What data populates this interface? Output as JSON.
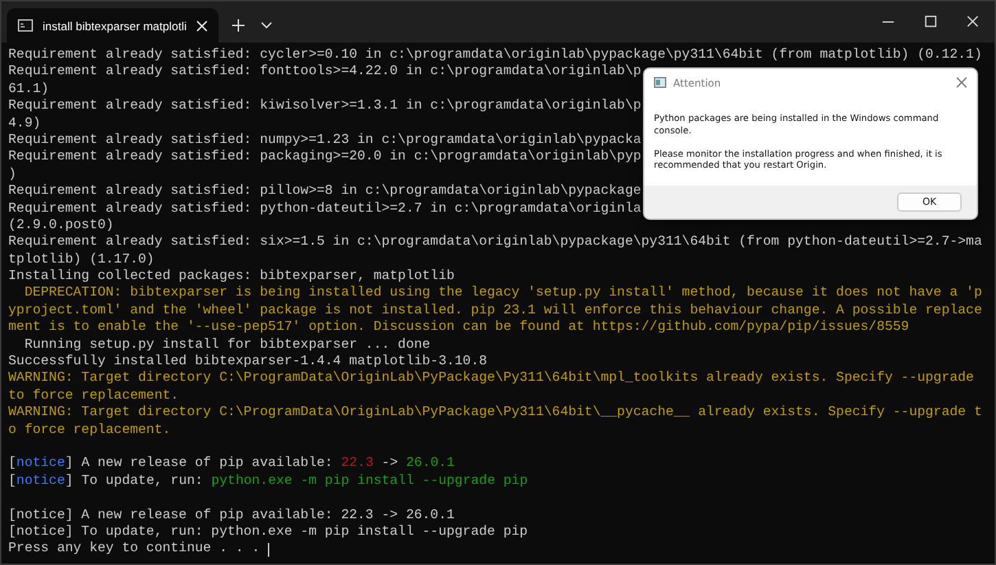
{
  "window": {
    "tab_title": "install bibtexparser matplotli"
  },
  "console": {
    "lines": [
      {
        "kind": "text",
        "segments": [
          {
            "kind": "plain",
            "text": "Requirement already satisfied: cycler>=0.10 in c:\\programdata\\originlab\\pypackage\\py311\\64bit (from matplotlib) (0.12.1)"
          }
        ]
      },
      {
        "kind": "text",
        "segments": [
          {
            "kind": "plain",
            "text": "Requirement already satisfied: fonttools>=4.22.0 in c:\\programdata\\originlab\\p"
          }
        ]
      },
      {
        "kind": "text",
        "segments": [
          {
            "kind": "plain",
            "text": "61.1)"
          }
        ]
      },
      {
        "kind": "text",
        "segments": [
          {
            "kind": "plain",
            "text": "Requirement already satisfied: kiwisolver>=1.3.1 in c:\\programdata\\originlab\\p"
          }
        ]
      },
      {
        "kind": "text",
        "segments": [
          {
            "kind": "plain",
            "text": "4.9)"
          }
        ]
      },
      {
        "kind": "text",
        "segments": [
          {
            "kind": "plain",
            "text": "Requirement already satisfied: numpy>=1.23 in c:\\programdata\\originlab\\pypacka"
          }
        ]
      },
      {
        "kind": "text",
        "segments": [
          {
            "kind": "plain",
            "text": "Requirement already satisfied: packaging>=20.0 in c:\\programdata\\originlab\\pyp"
          }
        ]
      },
      {
        "kind": "text",
        "segments": [
          {
            "kind": "plain",
            "text": ")"
          }
        ]
      },
      {
        "kind": "text",
        "segments": [
          {
            "kind": "plain",
            "text": "Requirement already satisfied: pillow>=8 in c:\\programdata\\originlab\\pypackage"
          }
        ]
      },
      {
        "kind": "text",
        "segments": [
          {
            "kind": "plain",
            "text": "Requirement already satisfied: python-dateutil>=2.7 in c:\\programdata\\originla"
          }
        ]
      },
      {
        "kind": "text",
        "segments": [
          {
            "kind": "plain",
            "text": "(2.9.0.post0)"
          }
        ]
      },
      {
        "kind": "text",
        "segments": [
          {
            "kind": "plain",
            "text": "Requirement already satisfied: six>=1.5 in c:\\programdata\\originlab\\pypackage\\py311\\64bit (from python-dateutil>=2.7->ma"
          }
        ]
      },
      {
        "kind": "text",
        "segments": [
          {
            "kind": "plain",
            "text": "tplotlib) (1.17.0)"
          }
        ]
      },
      {
        "kind": "text",
        "segments": [
          {
            "kind": "plain",
            "text": "Installing collected packages: bibtexparser, matplotlib"
          }
        ]
      },
      {
        "kind": "text",
        "segments": [
          {
            "kind": "warning",
            "text": "  DEPRECATION: bibtexparser is being installed using the legacy 'setup.py install' method, because it does not have a 'p"
          }
        ]
      },
      {
        "kind": "text",
        "segments": [
          {
            "kind": "warning",
            "text": "yproject.toml' and the 'wheel' package is not installed. pip 23.1 will enforce this behaviour change. A possible replace"
          }
        ]
      },
      {
        "kind": "text",
        "segments": [
          {
            "kind": "warning",
            "text": "ment is to enable the '--use-pep517' option. Discussion can be found at https://github.com/pypa/pip/issues/8559"
          }
        ]
      },
      {
        "kind": "text",
        "segments": [
          {
            "kind": "plain",
            "text": "  Running setup.py install for bibtexparser ... done"
          }
        ]
      },
      {
        "kind": "text",
        "segments": [
          {
            "kind": "plain",
            "text": "Successfully installed bibtexparser-1.4.4 matplotlib-3.10.8"
          }
        ]
      },
      {
        "kind": "text",
        "segments": [
          {
            "kind": "warning",
            "text": "WARNING: Target directory C:\\ProgramData\\OriginLab\\PyPackage\\Py311\\64bit\\mpl_toolkits already exists. Specify --upgrade"
          }
        ]
      },
      {
        "kind": "text",
        "segments": [
          {
            "kind": "warning",
            "text": "to force replacement."
          }
        ]
      },
      {
        "kind": "text",
        "segments": [
          {
            "kind": "warning",
            "text": "WARNING: Target directory C:\\ProgramData\\OriginLab\\PyPackage\\Py311\\64bit\\__pycache__ already exists. Specify --upgrade t"
          }
        ]
      },
      {
        "kind": "text",
        "segments": [
          {
            "kind": "warning",
            "text": "o force replacement."
          }
        ]
      },
      {
        "kind": "blank"
      },
      {
        "kind": "text",
        "segments": [
          {
            "kind": "plain",
            "text": "["
          },
          {
            "kind": "notice",
            "text": "notice"
          },
          {
            "kind": "plain",
            "text": "] A new release of pip available: "
          },
          {
            "kind": "old",
            "text": "22.3"
          },
          {
            "kind": "plain",
            "text": " -> "
          },
          {
            "kind": "new",
            "text": "26.0.1"
          }
        ]
      },
      {
        "kind": "text",
        "segments": [
          {
            "kind": "plain",
            "text": "["
          },
          {
            "kind": "notice",
            "text": "notice"
          },
          {
            "kind": "plain",
            "text": "] To update, run: "
          },
          {
            "kind": "new",
            "text": "python.exe -m pip install --upgrade pip"
          }
        ]
      },
      {
        "kind": "blank"
      },
      {
        "kind": "text",
        "segments": [
          {
            "kind": "plain",
            "text": "[notice] A new release of pip available: 22.3 -> 26.0.1"
          }
        ]
      },
      {
        "kind": "text",
        "segments": [
          {
            "kind": "plain",
            "text": "[notice] To update, run: python.exe -m pip install --upgrade pip"
          }
        ]
      },
      {
        "kind": "prompt",
        "segments": [
          {
            "kind": "plain",
            "text": "Press any key to continue . . . "
          }
        ]
      }
    ]
  },
  "dialog": {
    "title": "Attention",
    "paragraphs": [
      "Python packages are being installed in the Windows command console.",
      "Please monitor the installation progress and when finished, it is recommended that you restart Origin."
    ],
    "buttons": [
      "OK"
    ]
  }
}
